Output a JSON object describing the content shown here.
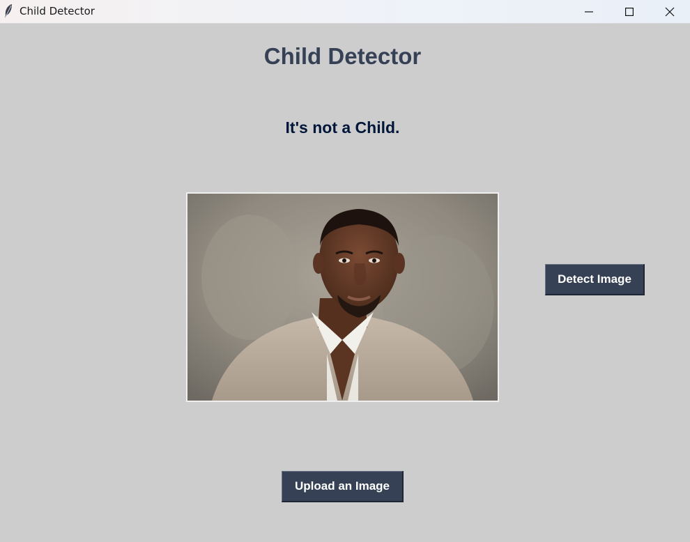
{
  "window": {
    "title": "Child Detector",
    "icon": "feather-icon",
    "controls": [
      "minimize-icon",
      "maximize-icon",
      "close-icon"
    ]
  },
  "main": {
    "heading": "Child Detector",
    "result_text": "It's not a Child.",
    "image_alt": "uploaded-photo",
    "detect_button_label": "Detect Image",
    "upload_button_label": "Upload an Image"
  },
  "colors": {
    "background": "#cdcdcd",
    "heading": "#364156",
    "result": "#011638",
    "button_bg": "#364156",
    "button_text": "#ffffff"
  }
}
